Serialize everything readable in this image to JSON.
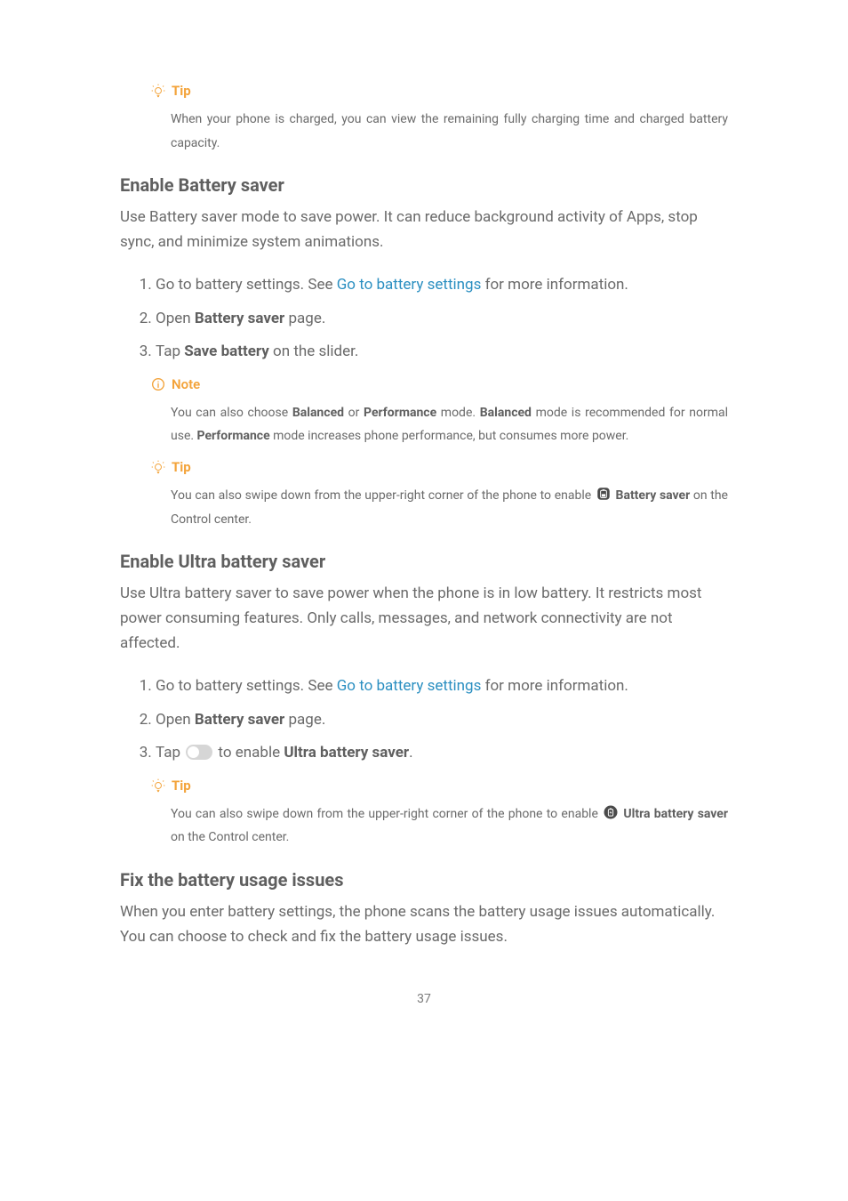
{
  "callout1": {
    "label": "Tip",
    "body": "When your phone is charged, you can view the remaining fully charging time and charged battery capacity."
  },
  "section1": {
    "heading": "Enable Battery saver",
    "intro": "Use Battery saver mode to save power. It can reduce background activity of Apps, stop sync, and minimize system animations.",
    "step1a": "Go to battery settings. See ",
    "step1_link": "Go to battery settings",
    "step1b": " for more information.",
    "step2a": "Open ",
    "step2_bold": "Battery saver",
    "step2b": " page.",
    "step3a": "Tap ",
    "step3_bold": "Save battery",
    "step3b": " on the slider."
  },
  "callout2": {
    "label": "Note",
    "body1": "You can also choose ",
    "bold1": "Balanced",
    "body2": " or ",
    "bold2": "Performance",
    "body3": " mode. ",
    "bold3": "Balanced",
    "body4": " mode is recommended for normal use. ",
    "bold4": "Performance",
    "body5": " mode increases phone performance, but consumes more power."
  },
  "callout3": {
    "label": "Tip",
    "body1": "You can also swipe down from the upper-right corner of the phone to enable ",
    "bold1": "Battery saver",
    "body2": " on the Control center."
  },
  "section2": {
    "heading": "Enable Ultra battery saver",
    "intro": "Use Ultra battery saver to save power when the phone is in low battery. It restricts most power consuming features. Only calls, messages, and network connectivity are not affected.",
    "step1a": "Go to battery settings. See ",
    "step1_link": "Go to battery settings",
    "step1b": " for more information.",
    "step2a": "Open ",
    "step2_bold": "Battery saver",
    "step2b": " page.",
    "step3a": "Tap ",
    "step3b": " to enable ",
    "step3_bold": "Ultra battery saver",
    "step3c": "."
  },
  "callout4": {
    "label": "Tip",
    "body1": "You can also swipe down from the upper-right corner of the phone to enable ",
    "bold1": "Ultra battery saver",
    "body2": " on the Control center."
  },
  "section3": {
    "heading": "Fix the battery usage issues",
    "intro": "When you enter battery settings, the phone scans the battery usage issues automatically. You can choose to check and fix the battery usage issues."
  },
  "pageNumber": "37",
  "icons": {
    "battery_saver": "battery-saver-icon",
    "ultra_battery": "ultra-battery-icon",
    "toggle": "toggle-off-icon"
  }
}
